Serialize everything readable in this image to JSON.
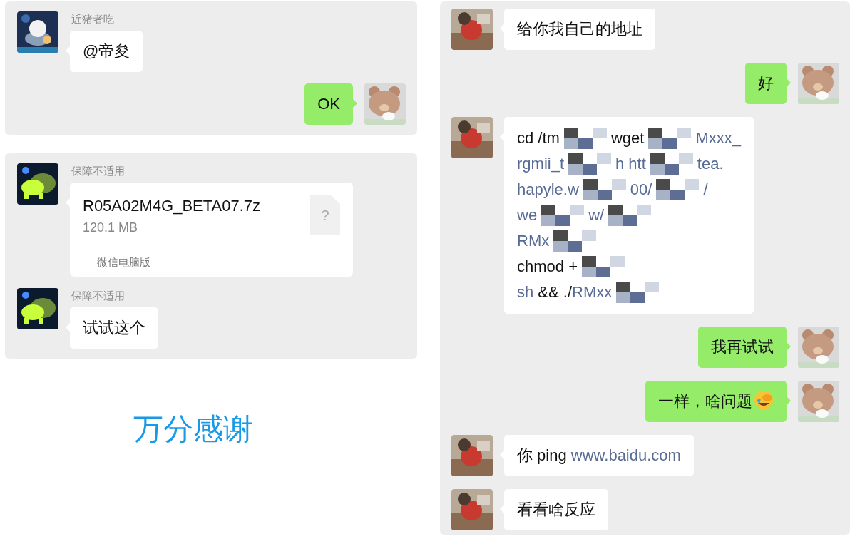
{
  "left_panel": {
    "groups": [
      {
        "messages": [
          {
            "outgoing": false,
            "kind": "text",
            "sender": "近猪者吃",
            "avatar": {
              "kind": "picture"
            },
            "text": "@帝夋"
          },
          {
            "outgoing": true,
            "kind": "text",
            "avatar": {
              "kind": "picture"
            },
            "text": "OK"
          }
        ]
      },
      {
        "messages": [
          {
            "outgoing": false,
            "kind": "file",
            "sender": "保障不适用",
            "avatar": {
              "kind": "picture"
            },
            "file_name": "R05A02M4G_BETA07.7z",
            "file_size": "120.1 MB",
            "file_icon": "?",
            "source": "微信电脑版"
          },
          {
            "outgoing": false,
            "kind": "text",
            "sender": "保障不适用",
            "avatar": {
              "kind": "picture"
            },
            "text": "试试这个"
          }
        ]
      }
    ]
  },
  "caption": "万分感谢",
  "right_panel": {
    "messages": [
      {
        "outgoing": false,
        "kind": "text",
        "avatar": {
          "kind": "picture"
        },
        "text": "给你我自己的地址"
      },
      {
        "outgoing": true,
        "kind": "text",
        "avatar": {
          "kind": "picture"
        },
        "text": "好"
      },
      {
        "outgoing": false,
        "kind": "code",
        "avatar": {
          "kind": "picture"
        },
        "lines": [
          [
            {
              "kind": "plain",
              "t": "cd /tm"
            },
            {
              "kind": "mosaic"
            },
            {
              "kind": "plain",
              "t": "wget"
            },
            {
              "kind": "mosaic"
            },
            {
              "kind": "link",
              "t": "Mxxx_"
            }
          ],
          [
            {
              "kind": "link",
              "t": "rgmii_t"
            },
            {
              "kind": "mosaic"
            },
            {
              "kind": "link",
              "t": "h htt"
            },
            {
              "kind": "mosaic"
            },
            {
              "kind": "link",
              "t": "tea."
            }
          ],
          [
            {
              "kind": "link",
              "t": "hapyle.w"
            },
            {
              "kind": "mosaic"
            },
            {
              "kind": "link",
              "t": "00/"
            },
            {
              "kind": "mosaic"
            },
            {
              "kind": "link",
              "t": "/"
            }
          ],
          [
            {
              "kind": "link",
              "t": "we"
            },
            {
              "kind": "mosaic"
            },
            {
              "kind": "link",
              "t": "w/"
            },
            {
              "kind": "mosaic"
            }
          ],
          [
            {
              "kind": "link",
              "t": "RMx"
            },
            {
              "kind": "mosaic"
            }
          ],
          [
            {
              "kind": "plain",
              "t": "chmod +"
            },
            {
              "kind": "mosaic"
            }
          ],
          [
            {
              "kind": "link",
              "t": "sh"
            },
            {
              "kind": "plain",
              "t": " && ./"
            },
            {
              "kind": "link",
              "t": "RMxx"
            },
            {
              "kind": "mosaic"
            }
          ]
        ]
      },
      {
        "outgoing": true,
        "kind": "text",
        "avatar": {
          "kind": "picture"
        },
        "text": "我再试试"
      },
      {
        "outgoing": true,
        "kind": "text",
        "avatar": {
          "kind": "picture"
        },
        "text": "一样，啥问题",
        "emoji": true
      },
      {
        "outgoing": false,
        "kind": "rich",
        "avatar": {
          "kind": "picture"
        },
        "segments": [
          {
            "kind": "plain",
            "t": "你 ping "
          },
          {
            "kind": "link",
            "t": "www.baidu.com"
          }
        ]
      },
      {
        "outgoing": false,
        "kind": "text",
        "avatar": {
          "kind": "picture"
        },
        "text": "看看啥反应"
      }
    ]
  }
}
